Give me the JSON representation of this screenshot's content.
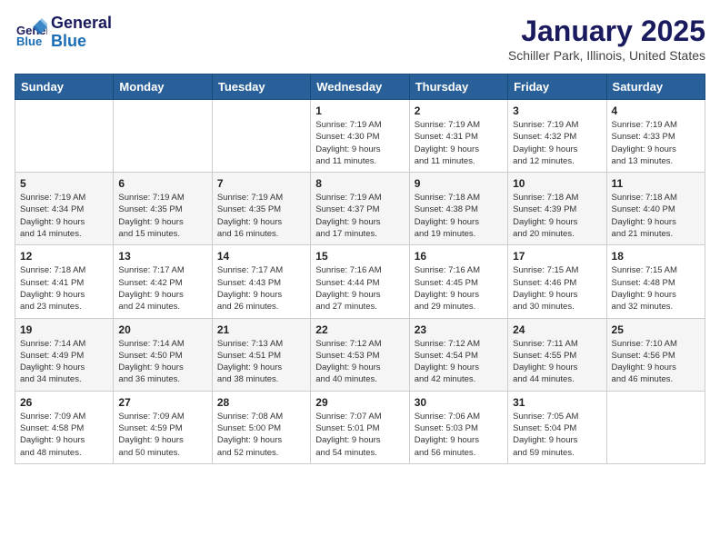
{
  "header": {
    "logo_line1": "General",
    "logo_line2": "Blue",
    "title": "January 2025",
    "subtitle": "Schiller Park, Illinois, United States"
  },
  "weekdays": [
    "Sunday",
    "Monday",
    "Tuesday",
    "Wednesday",
    "Thursday",
    "Friday",
    "Saturday"
  ],
  "weeks": [
    [
      {
        "day": "",
        "info": ""
      },
      {
        "day": "",
        "info": ""
      },
      {
        "day": "",
        "info": ""
      },
      {
        "day": "1",
        "info": "Sunrise: 7:19 AM\nSunset: 4:30 PM\nDaylight: 9 hours\nand 11 minutes."
      },
      {
        "day": "2",
        "info": "Sunrise: 7:19 AM\nSunset: 4:31 PM\nDaylight: 9 hours\nand 11 minutes."
      },
      {
        "day": "3",
        "info": "Sunrise: 7:19 AM\nSunset: 4:32 PM\nDaylight: 9 hours\nand 12 minutes."
      },
      {
        "day": "4",
        "info": "Sunrise: 7:19 AM\nSunset: 4:33 PM\nDaylight: 9 hours\nand 13 minutes."
      }
    ],
    [
      {
        "day": "5",
        "info": "Sunrise: 7:19 AM\nSunset: 4:34 PM\nDaylight: 9 hours\nand 14 minutes."
      },
      {
        "day": "6",
        "info": "Sunrise: 7:19 AM\nSunset: 4:35 PM\nDaylight: 9 hours\nand 15 minutes."
      },
      {
        "day": "7",
        "info": "Sunrise: 7:19 AM\nSunset: 4:35 PM\nDaylight: 9 hours\nand 16 minutes."
      },
      {
        "day": "8",
        "info": "Sunrise: 7:19 AM\nSunset: 4:37 PM\nDaylight: 9 hours\nand 17 minutes."
      },
      {
        "day": "9",
        "info": "Sunrise: 7:18 AM\nSunset: 4:38 PM\nDaylight: 9 hours\nand 19 minutes."
      },
      {
        "day": "10",
        "info": "Sunrise: 7:18 AM\nSunset: 4:39 PM\nDaylight: 9 hours\nand 20 minutes."
      },
      {
        "day": "11",
        "info": "Sunrise: 7:18 AM\nSunset: 4:40 PM\nDaylight: 9 hours\nand 21 minutes."
      }
    ],
    [
      {
        "day": "12",
        "info": "Sunrise: 7:18 AM\nSunset: 4:41 PM\nDaylight: 9 hours\nand 23 minutes."
      },
      {
        "day": "13",
        "info": "Sunrise: 7:17 AM\nSunset: 4:42 PM\nDaylight: 9 hours\nand 24 minutes."
      },
      {
        "day": "14",
        "info": "Sunrise: 7:17 AM\nSunset: 4:43 PM\nDaylight: 9 hours\nand 26 minutes."
      },
      {
        "day": "15",
        "info": "Sunrise: 7:16 AM\nSunset: 4:44 PM\nDaylight: 9 hours\nand 27 minutes."
      },
      {
        "day": "16",
        "info": "Sunrise: 7:16 AM\nSunset: 4:45 PM\nDaylight: 9 hours\nand 29 minutes."
      },
      {
        "day": "17",
        "info": "Sunrise: 7:15 AM\nSunset: 4:46 PM\nDaylight: 9 hours\nand 30 minutes."
      },
      {
        "day": "18",
        "info": "Sunrise: 7:15 AM\nSunset: 4:48 PM\nDaylight: 9 hours\nand 32 minutes."
      }
    ],
    [
      {
        "day": "19",
        "info": "Sunrise: 7:14 AM\nSunset: 4:49 PM\nDaylight: 9 hours\nand 34 minutes."
      },
      {
        "day": "20",
        "info": "Sunrise: 7:14 AM\nSunset: 4:50 PM\nDaylight: 9 hours\nand 36 minutes."
      },
      {
        "day": "21",
        "info": "Sunrise: 7:13 AM\nSunset: 4:51 PM\nDaylight: 9 hours\nand 38 minutes."
      },
      {
        "day": "22",
        "info": "Sunrise: 7:12 AM\nSunset: 4:53 PM\nDaylight: 9 hours\nand 40 minutes."
      },
      {
        "day": "23",
        "info": "Sunrise: 7:12 AM\nSunset: 4:54 PM\nDaylight: 9 hours\nand 42 minutes."
      },
      {
        "day": "24",
        "info": "Sunrise: 7:11 AM\nSunset: 4:55 PM\nDaylight: 9 hours\nand 44 minutes."
      },
      {
        "day": "25",
        "info": "Sunrise: 7:10 AM\nSunset: 4:56 PM\nDaylight: 9 hours\nand 46 minutes."
      }
    ],
    [
      {
        "day": "26",
        "info": "Sunrise: 7:09 AM\nSunset: 4:58 PM\nDaylight: 9 hours\nand 48 minutes."
      },
      {
        "day": "27",
        "info": "Sunrise: 7:09 AM\nSunset: 4:59 PM\nDaylight: 9 hours\nand 50 minutes."
      },
      {
        "day": "28",
        "info": "Sunrise: 7:08 AM\nSunset: 5:00 PM\nDaylight: 9 hours\nand 52 minutes."
      },
      {
        "day": "29",
        "info": "Sunrise: 7:07 AM\nSunset: 5:01 PM\nDaylight: 9 hours\nand 54 minutes."
      },
      {
        "day": "30",
        "info": "Sunrise: 7:06 AM\nSunset: 5:03 PM\nDaylight: 9 hours\nand 56 minutes."
      },
      {
        "day": "31",
        "info": "Sunrise: 7:05 AM\nSunset: 5:04 PM\nDaylight: 9 hours\nand 59 minutes."
      },
      {
        "day": "",
        "info": ""
      }
    ]
  ]
}
